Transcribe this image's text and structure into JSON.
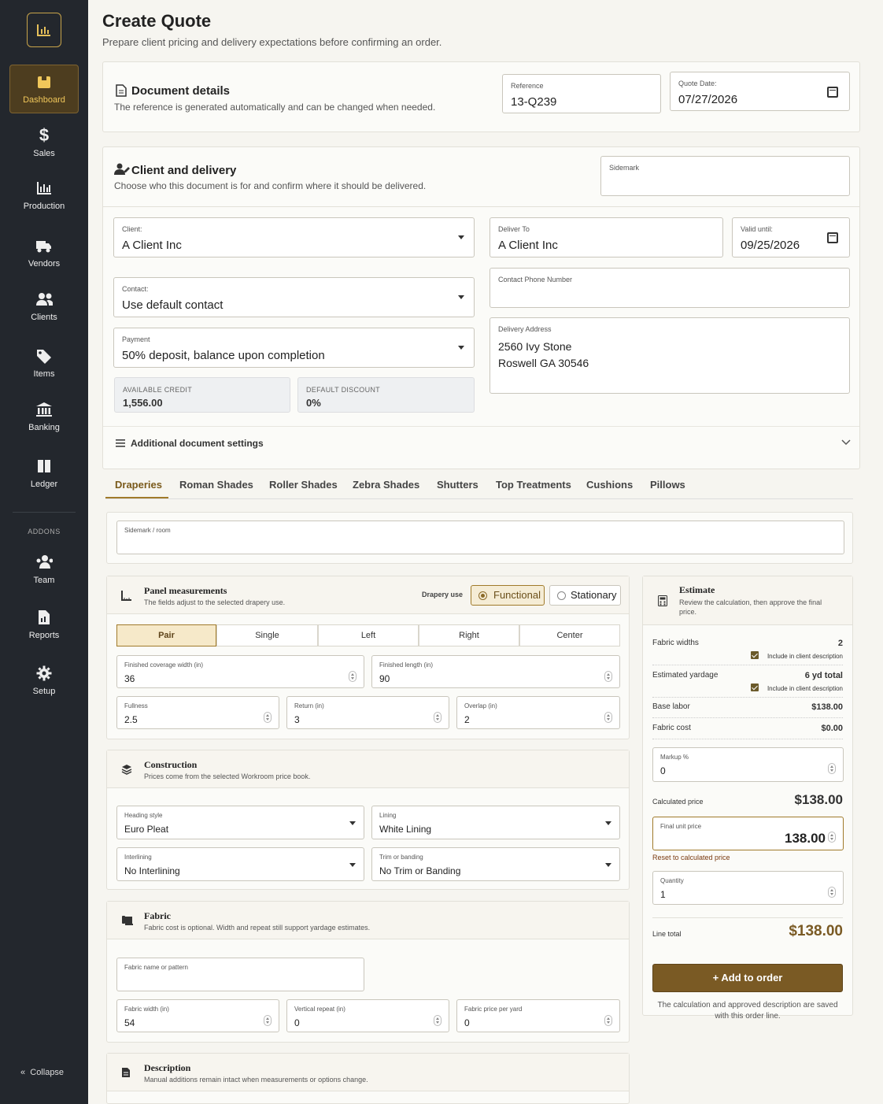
{
  "sidebar": {
    "items": [
      {
        "label": "Dashboard",
        "icon": "dashboard-icon"
      },
      {
        "label": "Sales",
        "icon": "dollar-icon"
      },
      {
        "label": "Production",
        "icon": "chart-icon"
      },
      {
        "label": "Vendors",
        "icon": "truck-icon"
      },
      {
        "label": "Clients",
        "icon": "users-icon"
      },
      {
        "label": "Items",
        "icon": "tags-icon"
      },
      {
        "label": "Banking",
        "icon": "bank-icon"
      },
      {
        "label": "Ledger",
        "icon": "book-icon"
      }
    ],
    "addons_label": "ADDONS",
    "addon_items": [
      {
        "label": "Team",
        "icon": "team-icon"
      },
      {
        "label": "Reports",
        "icon": "report-icon"
      },
      {
        "label": "Setup",
        "icon": "gear-icon"
      }
    ],
    "collapse_label": "Collapse"
  },
  "page": {
    "title": "Create Quote",
    "subtitle": "Prepare client pricing and delivery expectations before confirming an order."
  },
  "document_details": {
    "heading": "Document details",
    "desc": "The reference is generated automatically and can be changed when needed.",
    "reference_label": "Reference",
    "reference_value": "13-Q239",
    "quote_date_label": "Quote Date:",
    "quote_date_value": "07/27/2026"
  },
  "client_delivery": {
    "heading": "Client and delivery",
    "desc": "Choose who this document is for and confirm where it should be delivered.",
    "sidemark_label": "Sidemark",
    "client_label": "Client:",
    "client_value": "A Client Inc",
    "deliver_to_label": "Deliver To",
    "deliver_to_value": "A Client Inc",
    "valid_until_label": "Valid until:",
    "valid_until_value": "09/25/2026",
    "contact_label": "Contact:",
    "contact_value": "Use default contact",
    "phone_label": "Contact Phone Number",
    "payment_label": "Payment",
    "payment_value": "50% deposit, balance upon completion",
    "address_label": "Delivery Address",
    "address_line1": "2560 Ivy Stone",
    "address_line2": "Roswell GA 30546",
    "available_credit_label": "AVAILABLE CREDIT",
    "available_credit_value": "1,556.00",
    "default_discount_label": "DEFAULT DISCOUNT",
    "default_discount_value": "0%",
    "additional_settings": "Additional document settings"
  },
  "tabs": [
    "Draperies",
    "Roman Shades",
    "Roller Shades",
    "Zebra Shades",
    "Shutters",
    "Top Treatments",
    "Cushions",
    "Pillows"
  ],
  "sidemark_room_label": "Sidemark / room",
  "panel": {
    "heading": "Panel measurements",
    "desc": "The fields adjust to the selected drapery use.",
    "drapery_use_label": "Drapery use",
    "functional": "Functional",
    "stationary": "Stationary",
    "segments": [
      "Pair",
      "Single",
      "Left",
      "Right",
      "Center"
    ],
    "coverage_label": "Finished coverage width (in)",
    "coverage_value": "36",
    "length_label": "Finished length (in)",
    "length_value": "90",
    "fullness_label": "Fullness",
    "fullness_value": "2.5",
    "return_label": "Return (in)",
    "return_value": "3",
    "overlap_label": "Overlap (in)",
    "overlap_value": "2"
  },
  "construction": {
    "heading": "Construction",
    "desc": "Prices come from the selected Workroom price book.",
    "heading_style_label": "Heading style",
    "heading_style_value": "Euro Pleat",
    "lining_label": "Lining",
    "lining_value": "White Lining",
    "interlining_label": "Interlining",
    "interlining_value": "No Interlining",
    "trim_label": "Trim or banding",
    "trim_value": "No Trim or Banding"
  },
  "fabric": {
    "heading": "Fabric",
    "desc": "Fabric cost is optional. Width and repeat still support yardage estimates.",
    "name_label": "Fabric name or pattern",
    "width_label": "Fabric width (in)",
    "width_value": "54",
    "repeat_label": "Vertical repeat (in)",
    "repeat_value": "0",
    "price_label": "Fabric price per yard",
    "price_value": "0"
  },
  "description": {
    "heading": "Description",
    "desc": "Manual additions remain intact when measurements or options change."
  },
  "estimate": {
    "heading": "Estimate",
    "desc": "Review the calculation, then approve the final price.",
    "fabric_widths_label": "Fabric widths",
    "fabric_widths_value": "2",
    "include_label": "Include in client description",
    "yardage_label": "Estimated yardage",
    "yardage_value": "6 yd total",
    "base_labor_label": "Base labor",
    "base_labor_value": "$138.00",
    "fabric_cost_label": "Fabric cost",
    "fabric_cost_value": "$0.00",
    "markup_label": "Markup %",
    "markup_value": "0",
    "calculated_label": "Calculated price",
    "calculated_value": "$138.00",
    "final_label": "Final unit price",
    "final_value": "138.00",
    "reset_label": "Reset to calculated price",
    "quantity_label": "Quantity",
    "quantity_value": "1",
    "line_total_label": "Line total",
    "line_total_value": "$138.00",
    "add_button": "Add to order",
    "footnote": "The calculation and approved description are saved with this order line."
  },
  "colors": {
    "sidebar": "#23272d",
    "accent": "#7a5a24",
    "accent_gold": "#f0c75a"
  }
}
